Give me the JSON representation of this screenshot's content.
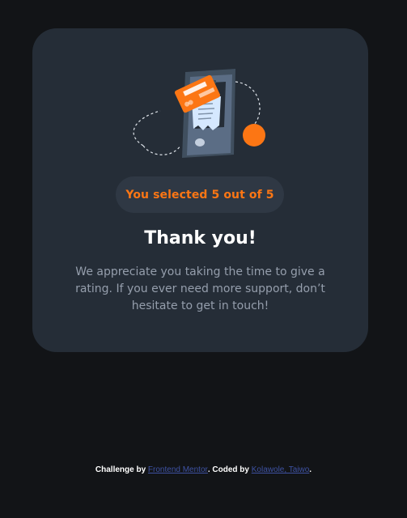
{
  "card": {
    "rating_message": "You selected 5 out of 5",
    "title": "Thank you!",
    "message": "We appreciate you taking the time to give a rating. If you ever need more support, don’t hesitate to get in touch!"
  },
  "illustration": {
    "icons": [
      "credit-card-icon",
      "phone-icon",
      "receipt-icon",
      "orange-dot-icon"
    ]
  },
  "attribution": {
    "prefix": "Challenge by ",
    "link1": "Frontend Mentor",
    "middle": ". Coded by ",
    "link2": "Kolawole, Taiwo",
    "suffix": "."
  },
  "colors": {
    "background": "#121417",
    "card": "#252d37",
    "accent": "#fc7614",
    "text_muted": "#959eac",
    "link": "#3e52a3"
  }
}
